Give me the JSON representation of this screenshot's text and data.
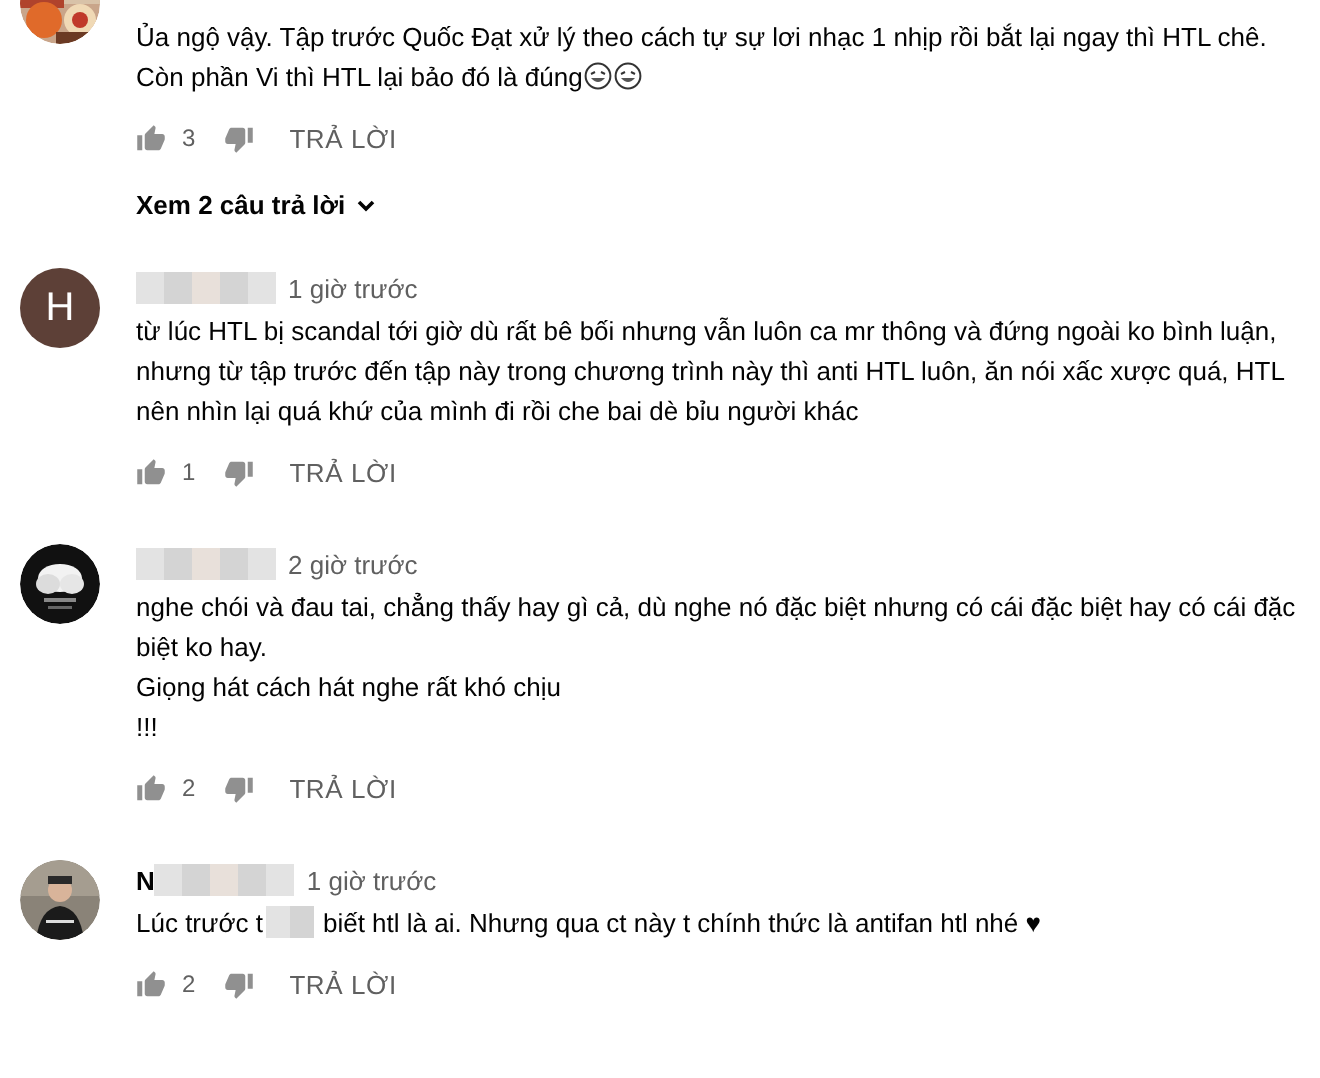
{
  "comments": [
    {
      "text": "Ủa ngộ vậy. Tập trước Quốc Đạt xử lý theo cách tự sự lơi nhạc 1 nhịp rồi bắt lại ngay thì HTL chê. Còn phần Vi thì HTL lại bảo đó là đúng",
      "emojis": [
        {
          "kind": "laughing"
        },
        {
          "kind": "laughing"
        }
      ],
      "likes": "3",
      "reply": "TRẢ LỜI",
      "replies_toggle": "Xem 2 câu trả lời"
    },
    {
      "avatar": {
        "kind": "letter",
        "letter": "H",
        "color": "#5d4037"
      },
      "time": "1 giờ trước",
      "text": "từ lúc HTL bị scandal tới giờ dù rất bê bối nhưng vẫn luôn ca mr thông và đứng ngoài ko bình luận, nhưng từ tập trước đến tập này trong chương trình này thì anti HTL luôn, ăn nói xấc xược quá, HTL nên nhìn lại quá khứ của mình đi rồi che bai dè bỉu người khác",
      "likes": "1",
      "reply": "TRẢ LỜI"
    },
    {
      "time": "2 giờ trước",
      "text": "nghe chói và đau tai, chẳng thấy hay gì cả, dù nghe nó đặc biệt nhưng có cái đặc biệt hay có cái đặc biệt ko hay.\nGiọng hát cách hát nghe rất khó chịu\n!!!",
      "likes": "2",
      "reply": "TRẢ LỜI"
    },
    {
      "name": "N",
      "time": "1 giờ trước",
      "text": "Lúc trước t",
      "text_after_blur": "biết htl là ai. Nhưng qua ct này t chính thức là antifan htl nhé ♥",
      "likes": "2",
      "reply": "TRẢ LỜI"
    }
  ]
}
